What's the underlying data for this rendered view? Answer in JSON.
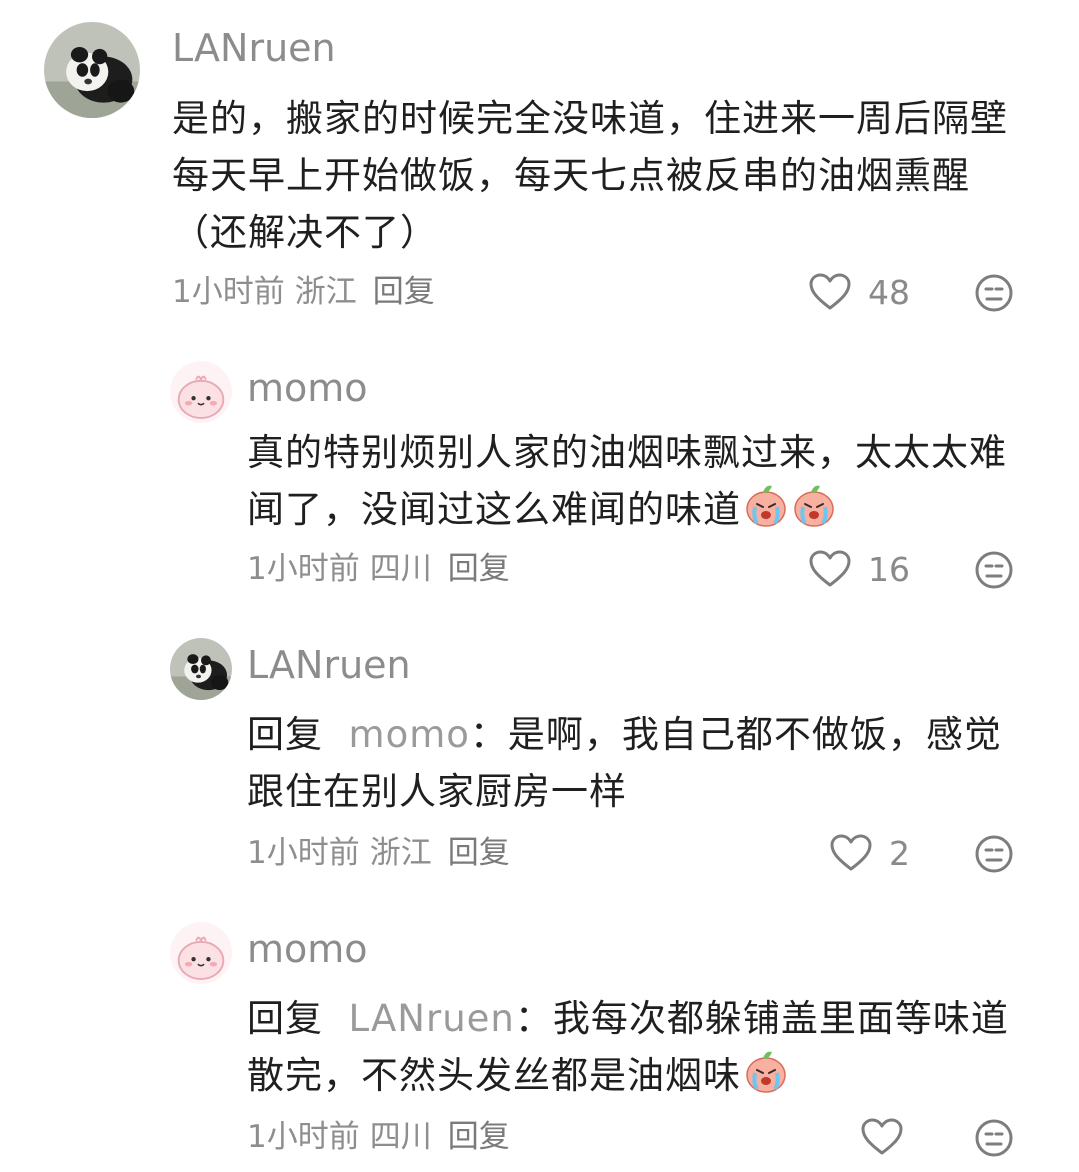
{
  "comments": [
    {
      "username": "LANruen",
      "text": "是的，搬家的时候完全没味道，住进来一周后隔壁每天早上开始做饭，每天七点被反串的油烟熏醒（还解决不了）",
      "time": "1小时前",
      "location": "浙江",
      "reply_label": "回复",
      "likes": "48",
      "avatar": "panda-avatar"
    },
    {
      "username": "momo",
      "text": "真的特别烦别人家的油烟味飘过来，太太太难闻了，没闻过这么难闻的味道",
      "emoji_count": 2,
      "time": "1小时前",
      "location": "四川",
      "reply_label": "回复",
      "likes": "16",
      "avatar": "pink-blob-avatar"
    },
    {
      "username": "LANruen",
      "reply_prefix": "回复",
      "reply_to": "momo",
      "text": "：是啊，我自己都不做饭，感觉跟住在别人家厨房一样",
      "time": "1小时前",
      "location": "浙江",
      "reply_label": "回复",
      "likes": "2",
      "avatar": "panda-avatar"
    },
    {
      "username": "momo",
      "reply_prefix": "回复",
      "reply_to": "LANruen",
      "text": "：我每次都躲铺盖里面等味道散完，不然头发丝都是油烟味",
      "emoji_count": 1,
      "time": "1小时前",
      "location": "四川",
      "reply_label": "回复",
      "likes": "",
      "avatar": "pink-blob-avatar"
    }
  ],
  "colors": {
    "username": "#8c8c8c",
    "body_text": "#1f1f1f",
    "meta_text": "#8e8e8e",
    "icon_stroke": "#7d7d7d",
    "avatar_pink": "#fbe3e6"
  },
  "icons": [
    "heart-outline-icon",
    "dislike-face-icon",
    "crying-peach-emoji"
  ]
}
